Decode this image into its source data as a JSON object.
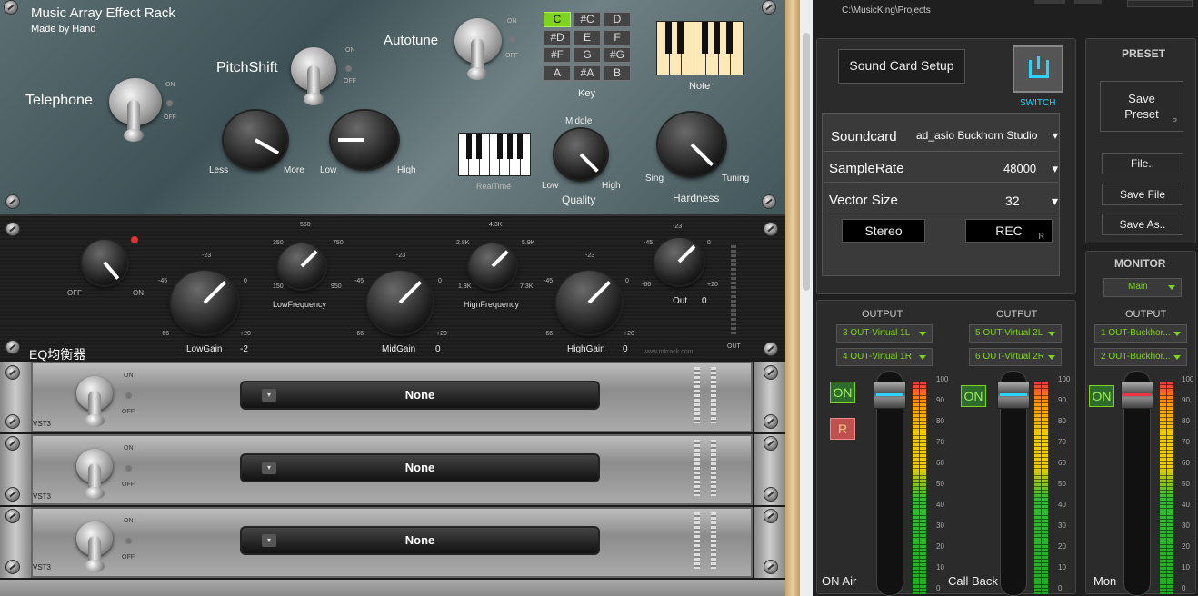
{
  "rack": {
    "title": "Music Array Effect Rack",
    "subtitle": "Made by Hand",
    "telephone": {
      "label": "Telephone",
      "on": "ON",
      "off": "OFF"
    },
    "pitchshift": {
      "label": "PitchShift",
      "on": "ON",
      "off": "OFF",
      "less": "Less",
      "more": "More",
      "low": "Low",
      "high": "High"
    },
    "autotune": {
      "label": "Autotune",
      "on": "ON",
      "off": "OFF"
    },
    "keys": [
      "C",
      "#C",
      "D",
      "#D",
      "E",
      "F",
      "#F",
      "G",
      "#G",
      "A",
      "#A",
      "B"
    ],
    "key_label": "Key",
    "note_label": "Note",
    "realtime_label": "RealTime",
    "quality": {
      "label": "Quality",
      "middle": "Middle",
      "low": "Low",
      "high": "High"
    },
    "hardness": {
      "label": "Hardness",
      "sing": "Sing",
      "tuning": "Tuning"
    }
  },
  "eq": {
    "title": "EQ均衡器",
    "off": "OFF",
    "on": "ON",
    "lowgain": {
      "label": "LowGain",
      "value": "-2",
      "min": "-66",
      "max": "+20",
      "l45": "-45",
      "l23": "-23",
      "zero": "0"
    },
    "lowfreq": {
      "label": "LowFrequency",
      "top": "550",
      "tl": "350",
      "tr": "750",
      "bl": "150",
      "br": "950"
    },
    "midgain": {
      "label": "MidGain",
      "value": "0",
      "min": "-66",
      "max": "+20",
      "l45": "-45",
      "l23": "-23",
      "zero": "0"
    },
    "highfreq": {
      "label": "HignFrequency",
      "top": "4.3K",
      "tl": "2.8K",
      "tr": "5.9K",
      "bl": "1.3K",
      "br": "7.3K"
    },
    "highgain": {
      "label": "HighGain",
      "value": "0",
      "min": "-66",
      "max": "+20",
      "l45": "-45",
      "l23": "-23",
      "zero": "0"
    },
    "out": {
      "label": "Out",
      "value": "0",
      "min": "-66",
      "max": "+20",
      "l45": "-45",
      "l23": "-23",
      "zero": "0"
    },
    "out_meter_label": "OUT",
    "watermark": "www.mkrack.com"
  },
  "plugins": [
    {
      "name": "None",
      "type": "VST3",
      "on": "ON",
      "off": "OFF"
    },
    {
      "name": "None",
      "type": "VST3",
      "on": "ON",
      "off": "OFF"
    },
    {
      "name": "None",
      "type": "VST3",
      "on": "ON",
      "off": "OFF"
    }
  ],
  "path": "C:\\MusicKing\\Projects",
  "soundcard": {
    "setup_button": "Sound Card Setup",
    "switch_label": "SWITCH",
    "rows": [
      {
        "label": "Soundcard",
        "value": "ad_asio Buckhorn Studio"
      },
      {
        "label": "SampleRate",
        "value": "48000"
      },
      {
        "label": "Vector Size",
        "value": "32"
      }
    ],
    "stereo_button": "Stereo",
    "rec_button": "REC",
    "rec_shortcut": "R"
  },
  "preset": {
    "title": "PRESET",
    "save_preset": "Save Preset",
    "save_preset_shortcut": "P",
    "file": "File..",
    "save_file": "Save File",
    "save_as": "Save As.."
  },
  "monitor": {
    "title": "MONITOR",
    "selected": "Main"
  },
  "channels": [
    {
      "output_label": "OUTPUT",
      "out1": "3 OUT-Virtual 1L",
      "out2": "4 OUT-Virtual 1R",
      "on": "ON",
      "r": "R",
      "name": "ON Air"
    },
    {
      "output_label": "OUTPUT",
      "out1": "5 OUT-Virtual 2L",
      "out2": "6 OUT-Virtual 2R",
      "on": "ON",
      "name": "Call Back"
    },
    {
      "output_label": "OUTPUT",
      "out1": "1 OUT-Buckhor...",
      "out2": "2 OUT-Buckhor...",
      "on": "ON",
      "name": "Mon"
    }
  ],
  "meter_scale": [
    "100",
    "90",
    "80",
    "70",
    "60",
    "50",
    "40",
    "30",
    "20",
    "10",
    "0"
  ],
  "colors": {
    "accent_green": "#7ed321",
    "switch_cyan": "#2ad4ff",
    "rec_red": "#c0504d"
  }
}
